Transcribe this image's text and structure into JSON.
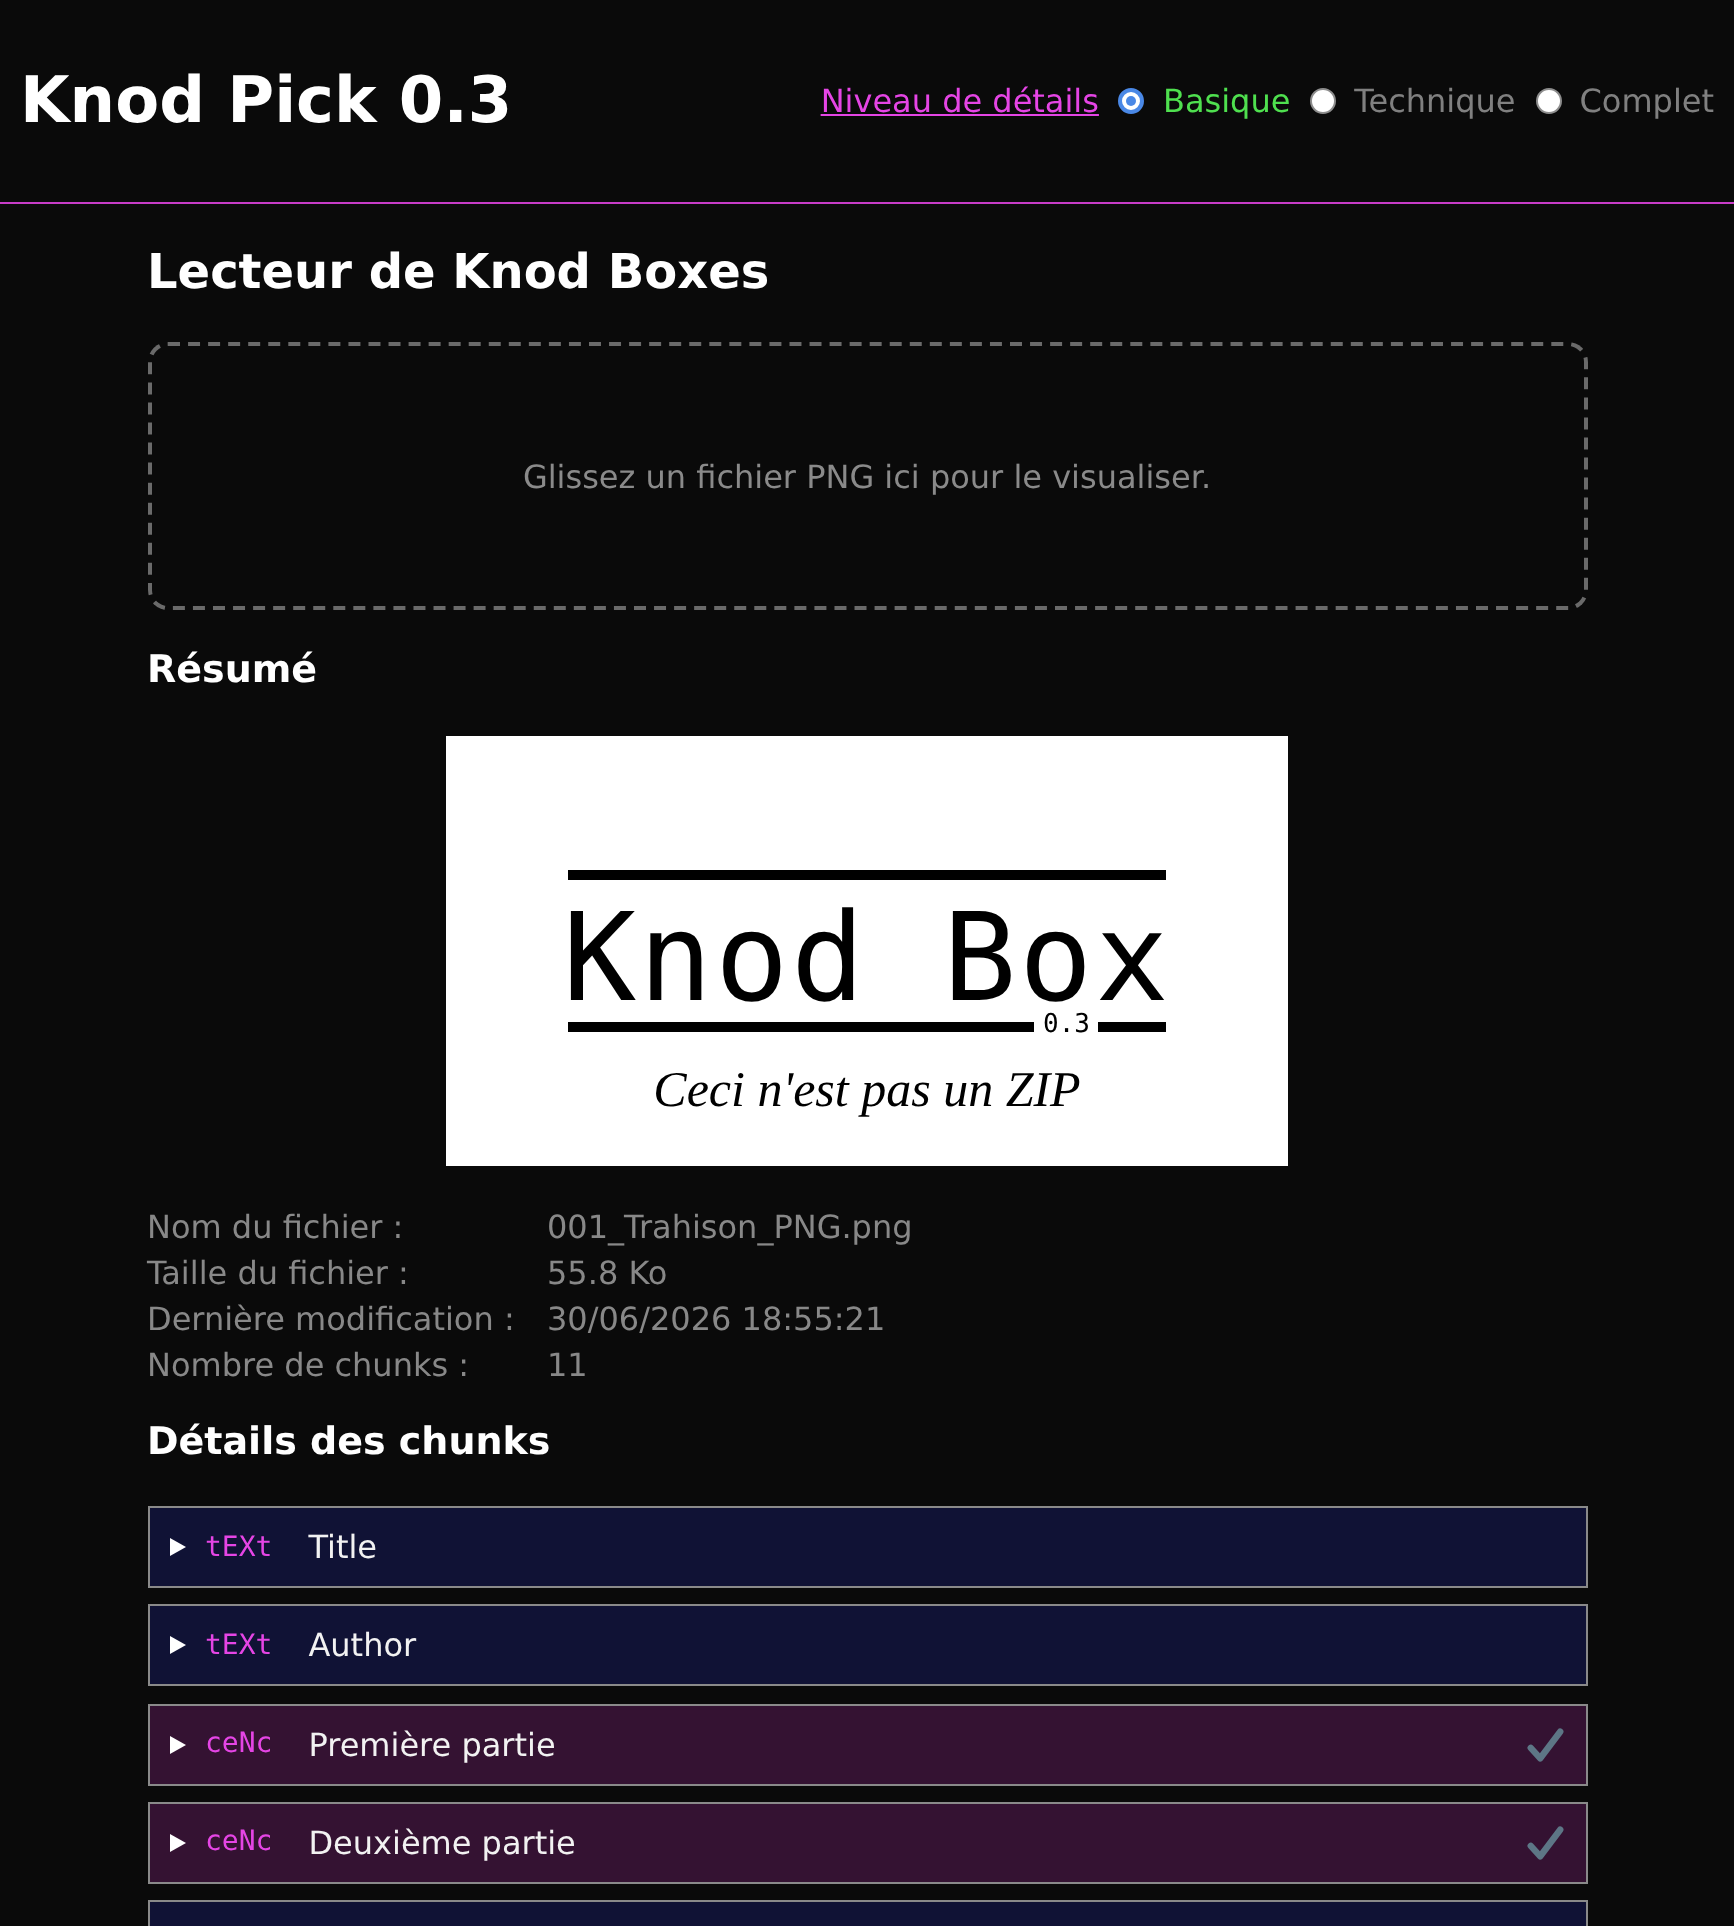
{
  "app": {
    "title": "Knod Pick 0.3"
  },
  "detail_level": {
    "label": "Niveau de détails",
    "options": [
      {
        "label": "Basique",
        "selected": true
      },
      {
        "label": "Technique",
        "selected": false
      },
      {
        "label": "Complet",
        "selected": false
      }
    ]
  },
  "reader": {
    "title": "Lecteur de Knod Boxes",
    "dropzone": {
      "text": "Glissez un fichier PNG ici pour le visualiser."
    }
  },
  "summary": {
    "title": "Résumé",
    "preview": {
      "title": "Knod Box",
      "version": "0.3",
      "tagline": "Ceci n'est pas un ZIP"
    },
    "fields": [
      {
        "label": "Nom du fichier :",
        "value": "001_Trahison_PNG.png"
      },
      {
        "label": "Taille du fichier :",
        "value": "55.8 Ko"
      },
      {
        "label": "Dernière modification :",
        "value": "30/06/2026 18:55:21"
      },
      {
        "label": "Nombre de chunks :",
        "value": "11"
      }
    ]
  },
  "chunks": {
    "title": "Détails des chunks",
    "items": [
      {
        "kind": "text",
        "type": "tEXt",
        "name": "Title",
        "expanded": false,
        "checked": false
      },
      {
        "kind": "text",
        "type": "tEXt",
        "name": "Author",
        "expanded": false,
        "checked": false
      },
      {
        "kind": "cenc",
        "type": "ceNc",
        "name": "Première partie",
        "expanded": false,
        "checked": true
      },
      {
        "kind": "cenc",
        "type": "ceNc",
        "name": "Deuxième partie",
        "expanded": false,
        "checked": true
      },
      {
        "kind": "text"
      }
    ]
  }
}
